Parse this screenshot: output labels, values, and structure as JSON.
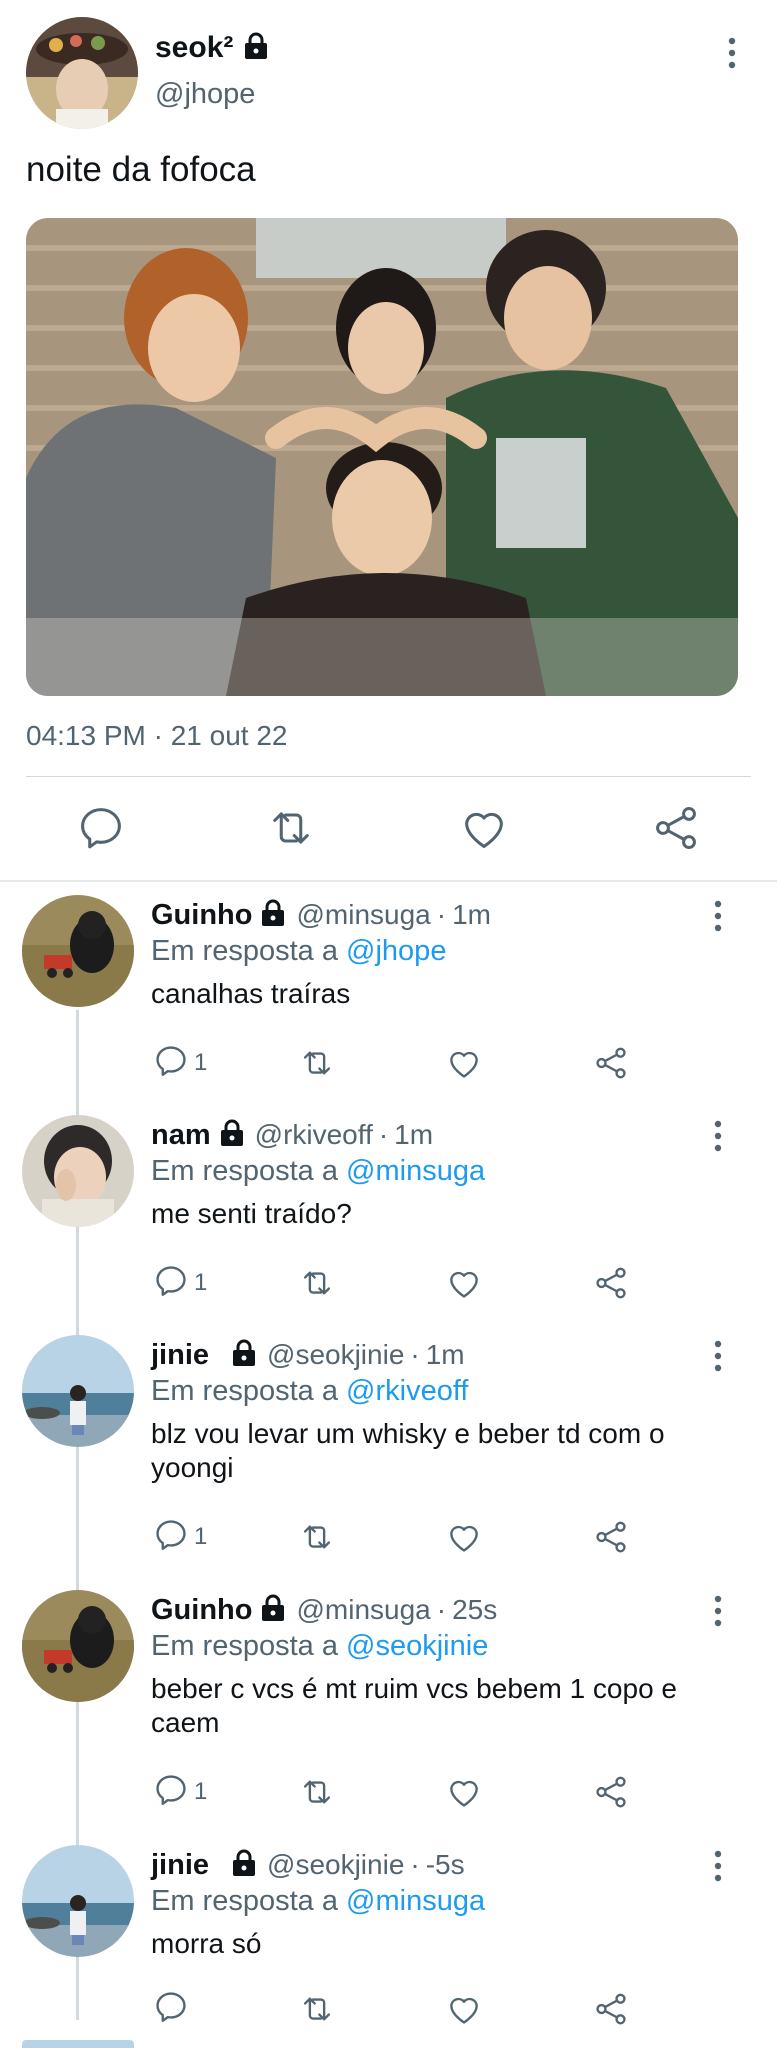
{
  "main_tweet": {
    "author": {
      "display_name": "seok²",
      "handle": "@jhope",
      "protected": true
    },
    "text": "noite da fofoca",
    "timestamp": "04:13 PM · 21 out 22",
    "actions": [
      "reply-icon",
      "retweet-icon",
      "like-icon",
      "share-icon"
    ]
  },
  "replies": [
    {
      "display_name": "Guinho",
      "handle": "@minsuga",
      "time": "1m",
      "replying_prefix": "Em resposta a",
      "replying_to": "@jhope",
      "text": "canalhas traíras",
      "reply_count": "1"
    },
    {
      "display_name": "nam",
      "handle": "@rkiveoff",
      "time": "1m",
      "replying_prefix": "Em resposta a",
      "replying_to": "@minsuga",
      "text": "me senti traído?",
      "reply_count": "1"
    },
    {
      "display_name": "jinie",
      "handle": "@seokjinie",
      "time": "1m",
      "replying_prefix": "Em resposta a",
      "replying_to": "@rkiveoff",
      "text": "blz vou levar um whisky e beber td com o yoongi",
      "reply_count": "1"
    },
    {
      "display_name": "Guinho",
      "handle": "@minsuga",
      "time": "25s",
      "replying_prefix": "Em resposta a",
      "replying_to": "@seokjinie",
      "text": "beber c vcs é mt ruim vcs bebem 1 copo e caem",
      "reply_count": "1"
    },
    {
      "display_name": "jinie",
      "handle": "@seokjinie",
      "time": "-5s",
      "replying_prefix": "Em resposta a",
      "replying_to": "@minsuga",
      "text": "morra só",
      "reply_count": ""
    }
  ],
  "colors": {
    "text": "#0f1419",
    "secondary": "#536471",
    "accent": "#1d9bf0",
    "divider": "#cfd9de"
  }
}
